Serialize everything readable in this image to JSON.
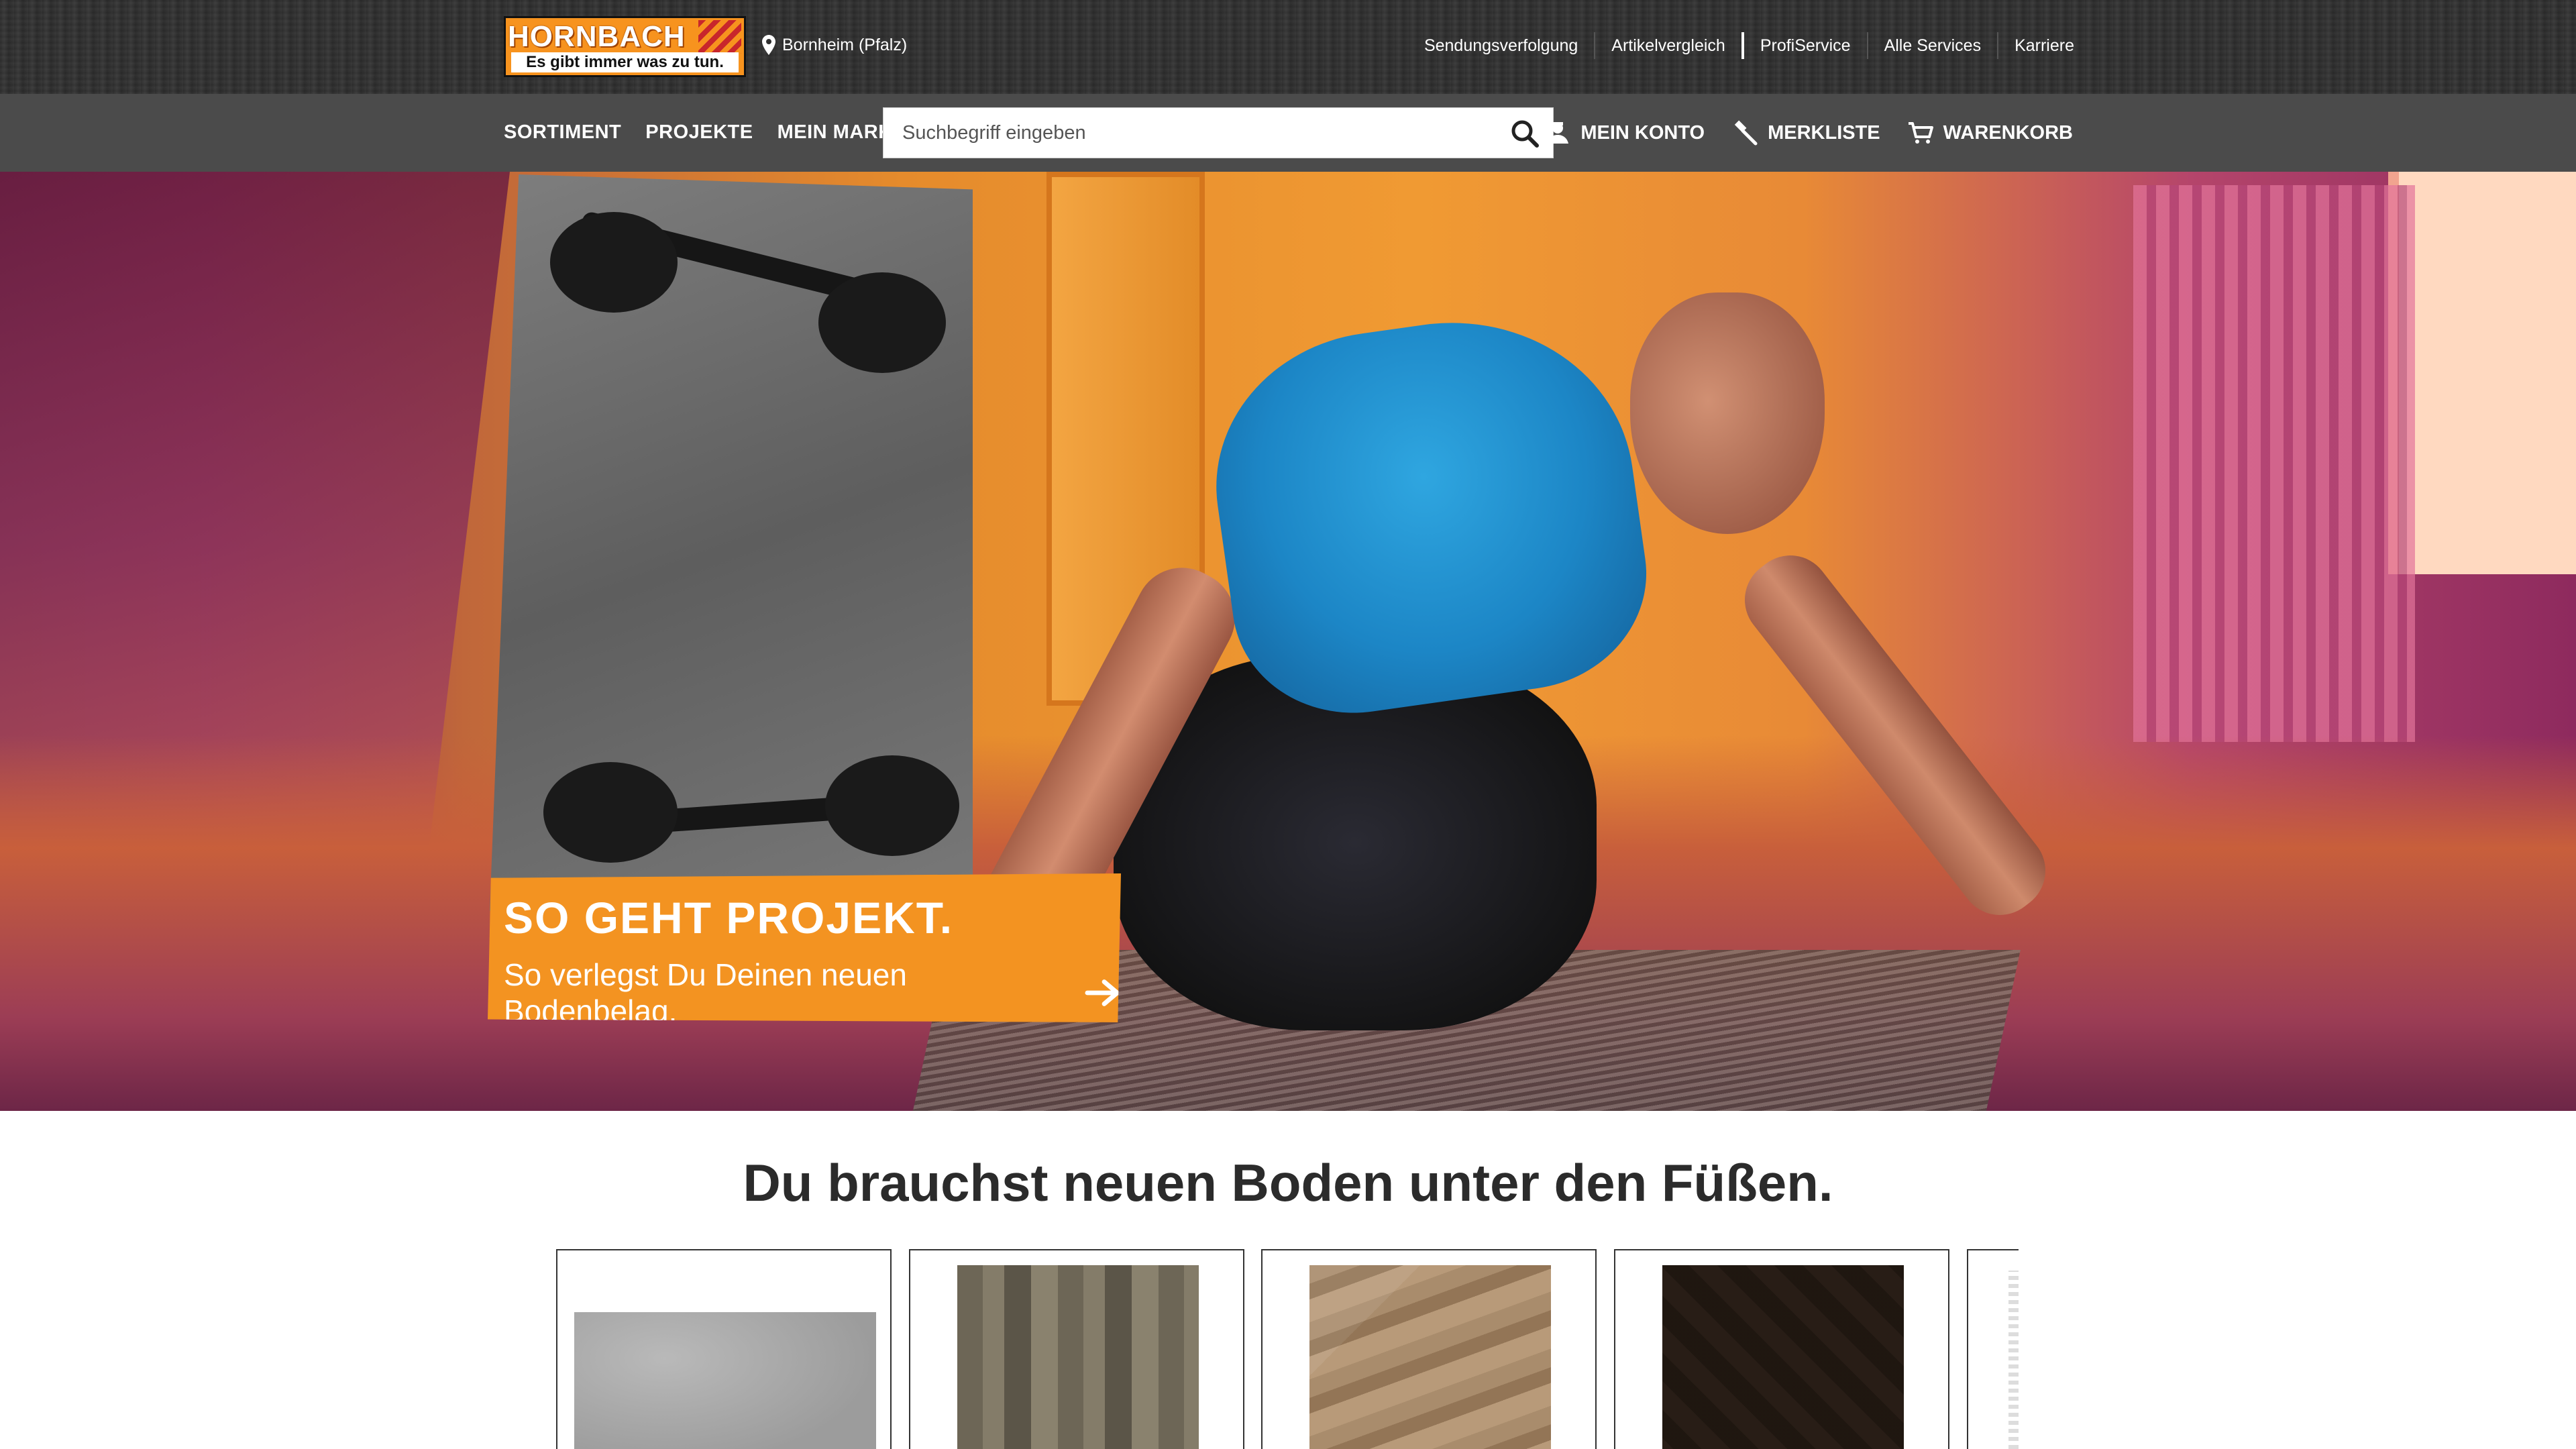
{
  "header": {
    "logo": {
      "brand": "HORNBACH",
      "slogan": "Es gibt immer was zu tun."
    },
    "location": "Bornheim (Pfalz)",
    "top_links": [
      "Sendungsverfolgung",
      "Artikelvergleich",
      "ProfiService",
      "Alle Services",
      "Karriere"
    ]
  },
  "nav": {
    "main": [
      "SORTIMENT",
      "PROJEKTE",
      "MEIN MARKT"
    ],
    "search": {
      "placeholder": "Suchbegriff eingeben",
      "value": ""
    },
    "user": [
      "MEIN KONTO",
      "MERKLISTE",
      "WARENKORB"
    ]
  },
  "hero": {
    "promo_title": "SO GEHT PROJEKT.",
    "promo_subtitle": "So verlegst Du Deinen neuen Bodenbelag."
  },
  "section": {
    "title": "Du brauchst neuen Boden unter den Füßen.",
    "cards": [
      "concrete-tile",
      "oak-wood",
      "laminate",
      "herringbone-parquet",
      "partial-card"
    ]
  },
  "colors": {
    "brand_orange": "#f39321",
    "topbar": "#333333",
    "navbar": "#4b4b4b"
  }
}
